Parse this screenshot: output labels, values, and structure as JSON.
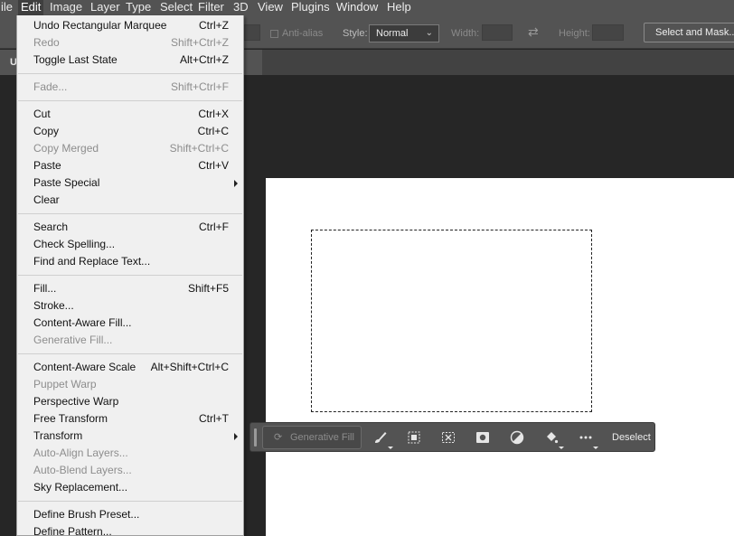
{
  "menubar": {
    "items": [
      "ile",
      "Edit",
      "Image",
      "Layer",
      "Type",
      "Select",
      "Filter",
      "3D",
      "View",
      "Plugins",
      "Window",
      "Help"
    ]
  },
  "options_bar": {
    "anti_alias_label": "Anti-alias",
    "style_label": "Style:",
    "style_value": "Normal",
    "width_label": "Width:",
    "height_label": "Height:",
    "select_and_mask_label": "Select and Mask..."
  },
  "tab": {
    "title": "U"
  },
  "edit_menu": {
    "items": [
      {
        "label": "Undo Rectangular Marquee",
        "shortcut": "Ctrl+Z",
        "disabled": false
      },
      {
        "label": "Redo",
        "shortcut": "Shift+Ctrl+Z",
        "disabled": true
      },
      {
        "label": "Toggle Last State",
        "shortcut": "Alt+Ctrl+Z",
        "disabled": false
      },
      {
        "label": "Fade...",
        "shortcut": "Shift+Ctrl+F",
        "disabled": true
      },
      {
        "label": "Cut",
        "shortcut": "Ctrl+X",
        "disabled": false
      },
      {
        "label": "Copy",
        "shortcut": "Ctrl+C",
        "disabled": false
      },
      {
        "label": "Copy Merged",
        "shortcut": "Shift+Ctrl+C",
        "disabled": true
      },
      {
        "label": "Paste",
        "shortcut": "Ctrl+V",
        "disabled": false
      },
      {
        "label": "Paste Special",
        "shortcut": "",
        "disabled": false,
        "submenu": true
      },
      {
        "label": "Clear",
        "shortcut": "",
        "disabled": false
      },
      {
        "label": "Search",
        "shortcut": "Ctrl+F",
        "disabled": false
      },
      {
        "label": "Check Spelling...",
        "shortcut": "",
        "disabled": false
      },
      {
        "label": "Find and Replace Text...",
        "shortcut": "",
        "disabled": false
      },
      {
        "label": "Fill...",
        "shortcut": "Shift+F5",
        "disabled": false
      },
      {
        "label": "Stroke...",
        "shortcut": "",
        "disabled": false
      },
      {
        "label": "Content-Aware Fill...",
        "shortcut": "",
        "disabled": false
      },
      {
        "label": "Generative Fill...",
        "shortcut": "",
        "disabled": true
      },
      {
        "label": "Content-Aware Scale",
        "shortcut": "Alt+Shift+Ctrl+C",
        "disabled": false
      },
      {
        "label": "Puppet Warp",
        "shortcut": "",
        "disabled": true
      },
      {
        "label": "Perspective Warp",
        "shortcut": "",
        "disabled": false
      },
      {
        "label": "Free Transform",
        "shortcut": "Ctrl+T",
        "disabled": false
      },
      {
        "label": "Transform",
        "shortcut": "",
        "disabled": false,
        "submenu": true
      },
      {
        "label": "Auto-Align Layers...",
        "shortcut": "",
        "disabled": true
      },
      {
        "label": "Auto-Blend Layers...",
        "shortcut": "",
        "disabled": true
      },
      {
        "label": "Sky Replacement...",
        "shortcut": "",
        "disabled": false
      },
      {
        "label": "Define Brush Preset...",
        "shortcut": "",
        "disabled": false
      },
      {
        "label": "Define Pattern...",
        "shortcut": "",
        "disabled": false
      }
    ]
  },
  "taskbar": {
    "generative_fill_label": "Generative Fill",
    "deselect_label": "Deselect",
    "icons": [
      "brush-icon",
      "select-subject-icon",
      "transform-selection-icon",
      "mask-icon",
      "adjustment-icon",
      "fill-bucket-icon",
      "more-icon"
    ]
  },
  "colors": {
    "chrome": "#535353",
    "workspace": "#262626",
    "menu_bg": "#f0f0f0",
    "canvas": "#ffffff"
  }
}
